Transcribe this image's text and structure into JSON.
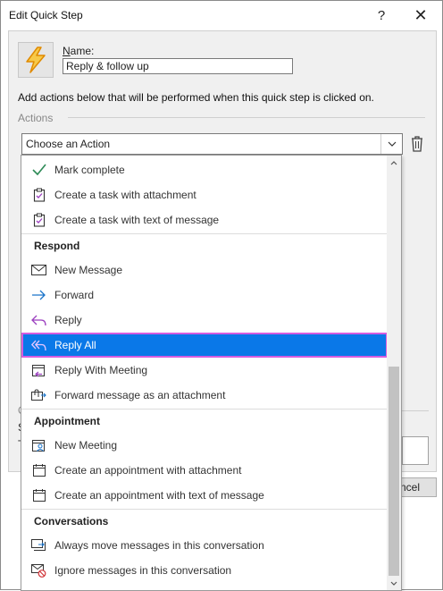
{
  "window": {
    "title": "Edit Quick Step",
    "help_glyph": "?",
    "close_glyph": "✕"
  },
  "form": {
    "name_label_accel": "N",
    "name_label_rest": "ame:",
    "name_value": "Reply & follow up",
    "description": "Add actions below that will be performed when this quick step is clicked on.",
    "actions_label": "Actions",
    "action_combo_value": "Choose an Action",
    "fragments": [
      "O",
      "S",
      "T"
    ],
    "cancel_visible_text": "ncel"
  },
  "dropdown": {
    "items": [
      {
        "label": "Mark complete",
        "icon": "checkmark-icon"
      },
      {
        "label": "Create a task with attachment",
        "icon": "task-icon"
      },
      {
        "label": "Create a task with text of message",
        "icon": "task-icon"
      },
      {
        "header": "Respond"
      },
      {
        "label": "New Message",
        "icon": "envelope-icon"
      },
      {
        "label": "Forward",
        "icon": "forward-arrow-icon"
      },
      {
        "label": "Reply",
        "icon": "reply-arrow-icon"
      },
      {
        "label": "Reply All",
        "icon": "reply-all-icon",
        "selected": true
      },
      {
        "label": "Reply With Meeting",
        "icon": "meeting-reply-icon"
      },
      {
        "label": "Forward message as an attachment",
        "icon": "attachment-forward-icon"
      },
      {
        "header": "Appointment"
      },
      {
        "label": "New Meeting",
        "icon": "new-meeting-icon"
      },
      {
        "label": "Create an appointment with attachment",
        "icon": "calendar-icon"
      },
      {
        "label": "Create an appointment with text of message",
        "icon": "calendar-icon"
      },
      {
        "header": "Conversations"
      },
      {
        "label": "Always move messages in this conversation",
        "icon": "move-conversation-icon"
      },
      {
        "label": "Ignore messages in this conversation",
        "icon": "ignore-conversation-icon"
      }
    ]
  },
  "colors": {
    "selection": "#0a78e8",
    "selection_outline": "#d55ce0",
    "accent_green": "#2e8b57",
    "accent_purple": "#9b3fbf",
    "accent_blue": "#1a73c9"
  }
}
